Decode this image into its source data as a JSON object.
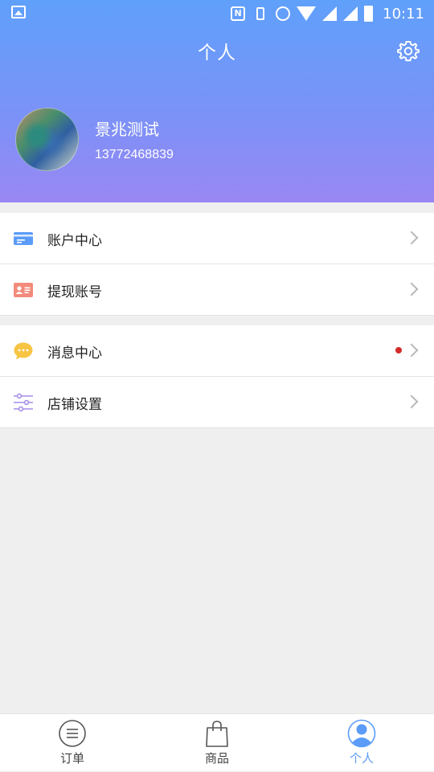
{
  "status_bar": {
    "time": "10:11",
    "nfc_letter": "N"
  },
  "header": {
    "title": "个人"
  },
  "profile": {
    "name": "景兆测试",
    "phone": "13772468839"
  },
  "menu_group_1": [
    {
      "label": "账户中心",
      "icon": "card-icon"
    },
    {
      "label": "提现账号",
      "icon": "id-card-icon"
    }
  ],
  "menu_group_2": [
    {
      "label": "消息中心",
      "icon": "chat-bubble-icon",
      "has_unread_dot": true
    },
    {
      "label": "店铺设置",
      "icon": "sliders-icon"
    }
  ],
  "tabs": [
    {
      "label": "订单",
      "icon": "list-icon",
      "active": false
    },
    {
      "label": "商品",
      "icon": "shopping-bag-icon",
      "active": false
    },
    {
      "label": "个人",
      "icon": "person-icon",
      "active": true
    }
  ],
  "colors": {
    "header_top": "#5fa0fb",
    "header_bottom": "#9a87f3",
    "active_tab": "#5a9cf8",
    "unread_dot": "#d42a2a"
  }
}
